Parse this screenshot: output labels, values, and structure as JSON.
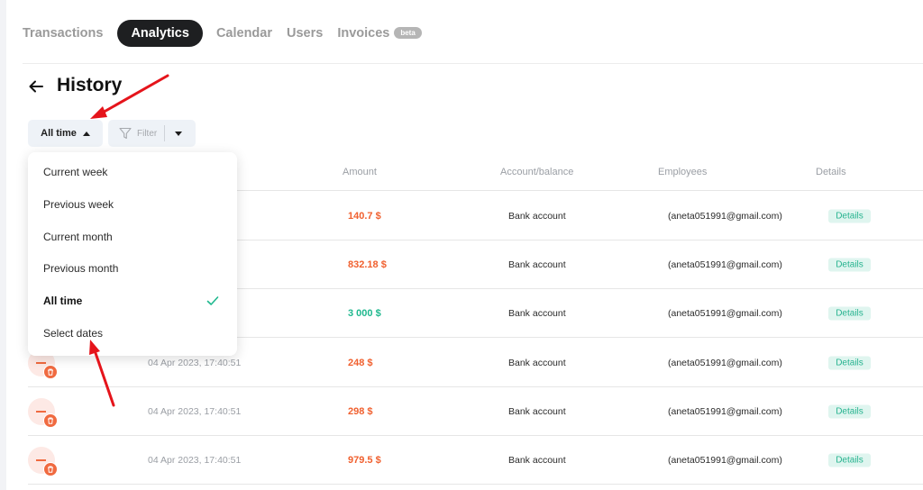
{
  "nav": {
    "tabs": [
      {
        "label": "Transactions",
        "active": false
      },
      {
        "label": "Analytics",
        "active": true
      },
      {
        "label": "Calendar",
        "active": false
      },
      {
        "label": "Users",
        "active": false
      },
      {
        "label": "Invoices",
        "active": false,
        "badge": "beta"
      }
    ]
  },
  "header": {
    "title": "History",
    "back_icon": "arrow-left-icon"
  },
  "filters": {
    "time_label": "All time",
    "filter_label": "Filter"
  },
  "dropdown": {
    "items": [
      {
        "label": "Current week",
        "selected": false
      },
      {
        "label": "Previous week",
        "selected": false
      },
      {
        "label": "Current month",
        "selected": false
      },
      {
        "label": "Previous month",
        "selected": false
      },
      {
        "label": "All time",
        "selected": true
      },
      {
        "label": "Select dates",
        "selected": false
      }
    ]
  },
  "table": {
    "columns": [
      "Amount",
      "Account/balance",
      "Employees",
      "Details"
    ],
    "rows": [
      {
        "date": "",
        "amount": "140.7 $",
        "type": "expense",
        "account": "Bank account",
        "employee": "(aneta051991@gmail.com)",
        "details": "Details"
      },
      {
        "date": "",
        "amount": "832.18 $",
        "type": "expense",
        "account": "Bank account",
        "employee": "(aneta051991@gmail.com)",
        "details": "Details"
      },
      {
        "date": "",
        "amount": "3 000 $",
        "type": "income",
        "account": "Bank account",
        "employee": "(aneta051991@gmail.com)",
        "details": "Details"
      },
      {
        "date": "04 Apr 2023, 17:40:51",
        "amount": "248 $",
        "type": "expense",
        "account": "Bank account",
        "employee": "(aneta051991@gmail.com)",
        "details": "Details"
      },
      {
        "date": "04 Apr 2023, 17:40:51",
        "amount": "298 $",
        "type": "expense",
        "account": "Bank account",
        "employee": "(aneta051991@gmail.com)",
        "details": "Details"
      },
      {
        "date": "04 Apr 2023, 17:40:51",
        "amount": "979.5 $",
        "type": "expense",
        "account": "Bank account",
        "employee": "(aneta051991@gmail.com)",
        "details": "Details"
      }
    ]
  },
  "colors": {
    "expense": "#f0602f",
    "income": "#1fb88e",
    "annotation": "#e5141b",
    "active_tab": "#1e1f21"
  }
}
